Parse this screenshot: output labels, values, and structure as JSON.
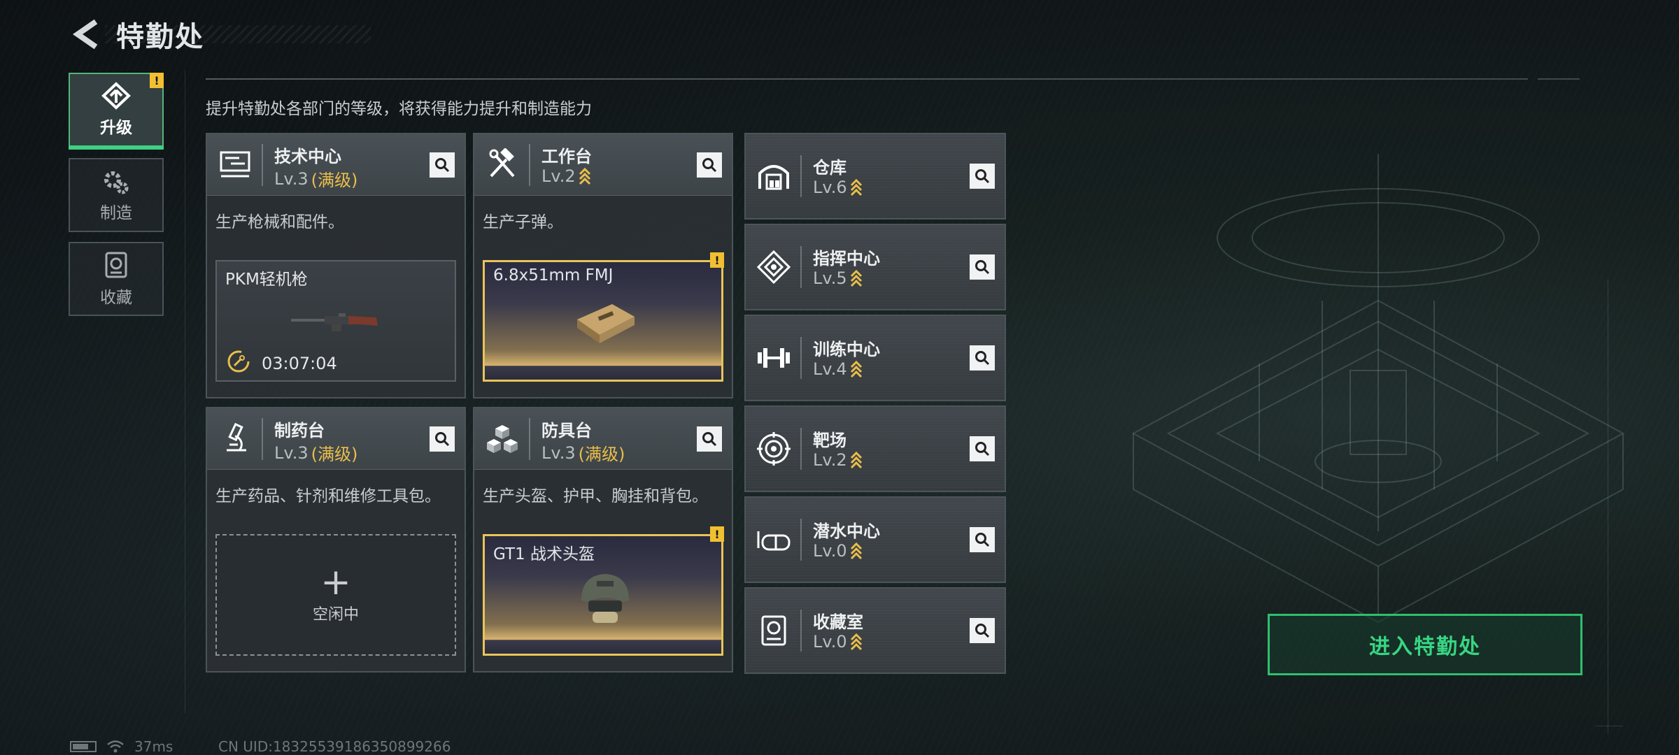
{
  "header": {
    "title": "特勤处"
  },
  "nav": {
    "items": [
      {
        "label": "升级",
        "badge": "!",
        "active": true
      },
      {
        "label": "制造"
      },
      {
        "label": "收藏"
      }
    ]
  },
  "subtitle": "提升特勤处各部门的等级，将获得能力提升和制造能力",
  "cards": [
    {
      "name": "技术中心",
      "level": "Lv.3",
      "status": "(满级)",
      "desc": "生产枪械和配件。",
      "slot": {
        "name": "PKM轻机枪",
        "time": "03:07:04"
      }
    },
    {
      "name": "工作台",
      "level": "Lv.2",
      "desc": "生产子弹。",
      "slot": {
        "name": "6.8x51mm FMJ",
        "badge": "!"
      }
    },
    {
      "name": "制药台",
      "level": "Lv.3",
      "status": "(满级)",
      "desc": "生产药品、针剂和维修工具包。",
      "slot": {
        "idle_label": "空闲中"
      }
    },
    {
      "name": "防具台",
      "level": "Lv.3",
      "status": "(满级)",
      "desc": "生产头盔、护甲、胸挂和背包。",
      "slot": {
        "name": "GT1 战术头盔",
        "badge": "!"
      }
    }
  ],
  "side_cards": [
    {
      "name": "仓库",
      "level": "Lv.6"
    },
    {
      "name": "指挥中心",
      "level": "Lv.5"
    },
    {
      "name": "训练中心",
      "level": "Lv.4"
    },
    {
      "name": "靶场",
      "level": "Lv.2"
    },
    {
      "name": "潜水中心",
      "level": "Lv.0"
    },
    {
      "name": "收藏室",
      "level": "Lv.0"
    }
  ],
  "enter_button": "进入特勤处",
  "status_bar": {
    "ping": "37ms",
    "uid": "CN UID:18325539186350899266"
  },
  "colors": {
    "accent_green": "#38d683",
    "gold": "#e9be4b",
    "badge_yellow": "#f1c032"
  }
}
